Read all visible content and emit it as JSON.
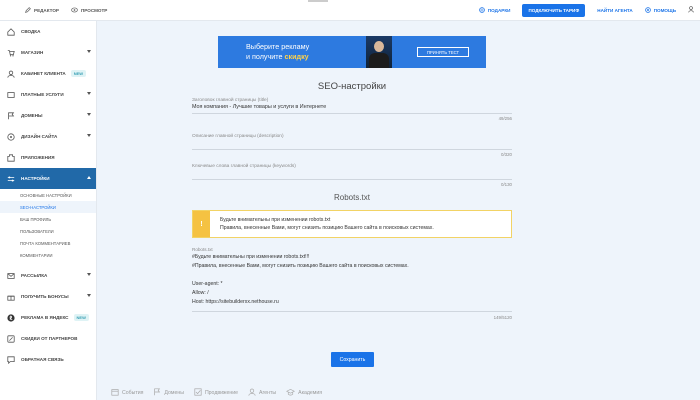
{
  "topbar": {
    "editor": "Редактор",
    "preview": "Просмотр",
    "gifts": "Подарки",
    "connect_tariff": "Подключить тариф",
    "find_agent": "Найти агента",
    "help": "Помощь"
  },
  "sidebar": {
    "items": [
      {
        "label": "Сводка"
      },
      {
        "label": "Магазин"
      },
      {
        "label": "Кабинет клиента",
        "badge": "new"
      },
      {
        "label": "Платные услуги"
      },
      {
        "label": "Домены"
      },
      {
        "label": "Дизайн сайта"
      },
      {
        "label": "Приложения"
      },
      {
        "label": "Настройки"
      },
      {
        "label": "Рассылка"
      },
      {
        "label": "Получить бонусы"
      },
      {
        "label": "Реклама в Яндекс",
        "badge": "new"
      },
      {
        "label": "Скидки от партнеров"
      },
      {
        "label": "Обратная связь"
      }
    ],
    "sub_items": [
      "Основные настройки",
      "SEO-настройки",
      "Ваш профиль",
      "Пользователи",
      "Почта комментариев",
      "Комментарии"
    ]
  },
  "banner": {
    "line1": "Выберите рекламу",
    "line2_prefix": "и получите ",
    "line2_highlight": "скидку",
    "button": "Принять тест"
  },
  "seo": {
    "title": "SEO-настройки",
    "title_field": {
      "label": "Заголовок главной страницы (title)",
      "value": "Моя компания - Лучшие товары и услуги в Интернете",
      "count": "49/256"
    },
    "description_field": {
      "label": "Описание главной страницы (description)",
      "value": "",
      "count": "0/320"
    },
    "keywords_field": {
      "label": "Ключевые слова главной страницы (keywords)",
      "value": "",
      "count": "0/130"
    }
  },
  "robots": {
    "title": "Robots.txt",
    "warning_line1": "Будьте внимательны при изменении robots.txt",
    "warning_line2": "Правила, внесенные Вами, могут снизить позицию Вашего сайта в поисковых системах.",
    "label": "Robots.txt",
    "content": "#Будьте внимательны при изменении robots.txt!!!\n#Правила, внесенные Вами, могут снизить позицию Вашего сайта в поисковых системах.\n\nUser-agent: *\nAllow: /\nHost: https://sitebuilderxx.nethouse.ru",
    "count": "149/5120"
  },
  "save_button": "Сохранить",
  "footer": {
    "events": "События",
    "domains": "Домены",
    "promotion": "Продвижение",
    "agents": "Агенты",
    "academy": "Академия"
  },
  "colors": {
    "accent": "#1a73e8",
    "active_nav": "#2169a8",
    "warning": "#f5c242",
    "background": "#eef4fb"
  }
}
